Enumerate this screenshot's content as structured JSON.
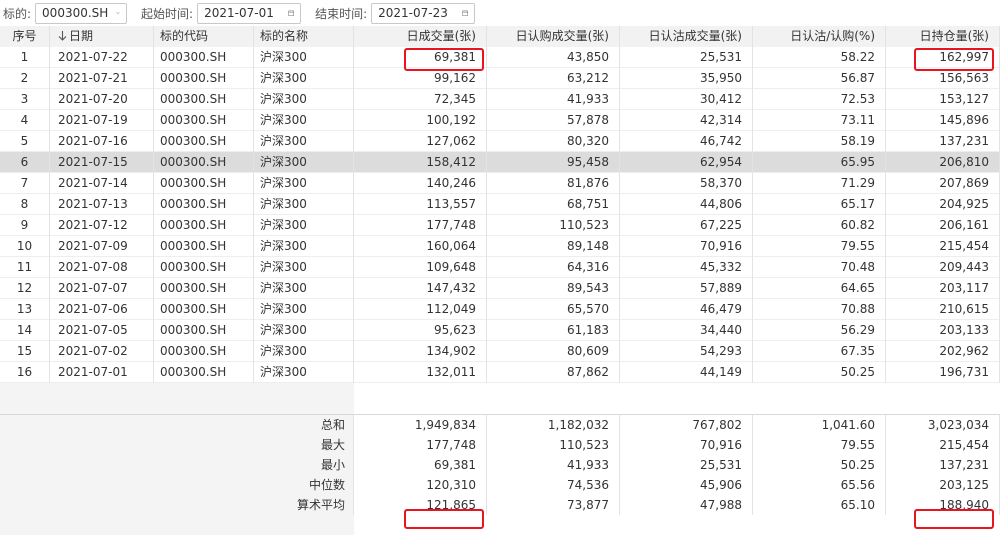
{
  "toolbar": {
    "symbol_label": "标的:",
    "symbol_value": "000300.SH",
    "start_label": "起始时间:",
    "start_value": "2021-07-01",
    "end_label": "结束时间:",
    "end_value": "2021-07-23"
  },
  "table": {
    "headers": [
      "序号",
      "日期",
      "标的代码",
      "标的名称",
      "日成交量(张)",
      "日认购成交量(张)",
      "日认沽成交量(张)",
      "日认沽/认购(%)",
      "日持仓量(张)"
    ],
    "rows": [
      [
        "1",
        "2021-07-22",
        "000300.SH",
        "沪深300",
        "69,381",
        "43,850",
        "25,531",
        "58.22",
        "162,997"
      ],
      [
        "2",
        "2021-07-21",
        "000300.SH",
        "沪深300",
        "99,162",
        "63,212",
        "35,950",
        "56.87",
        "156,563"
      ],
      [
        "3",
        "2021-07-20",
        "000300.SH",
        "沪深300",
        "72,345",
        "41,933",
        "30,412",
        "72.53",
        "153,127"
      ],
      [
        "4",
        "2021-07-19",
        "000300.SH",
        "沪深300",
        "100,192",
        "57,878",
        "42,314",
        "73.11",
        "145,896"
      ],
      [
        "5",
        "2021-07-16",
        "000300.SH",
        "沪深300",
        "127,062",
        "80,320",
        "46,742",
        "58.19",
        "137,231"
      ],
      [
        "6",
        "2021-07-15",
        "000300.SH",
        "沪深300",
        "158,412",
        "95,458",
        "62,954",
        "65.95",
        "206,810"
      ],
      [
        "7",
        "2021-07-14",
        "000300.SH",
        "沪深300",
        "140,246",
        "81,876",
        "58,370",
        "71.29",
        "207,869"
      ],
      [
        "8",
        "2021-07-13",
        "000300.SH",
        "沪深300",
        "113,557",
        "68,751",
        "44,806",
        "65.17",
        "204,925"
      ],
      [
        "9",
        "2021-07-12",
        "000300.SH",
        "沪深300",
        "177,748",
        "110,523",
        "67,225",
        "60.82",
        "206,161"
      ],
      [
        "10",
        "2021-07-09",
        "000300.SH",
        "沪深300",
        "160,064",
        "89,148",
        "70,916",
        "79.55",
        "215,454"
      ],
      [
        "11",
        "2021-07-08",
        "000300.SH",
        "沪深300",
        "109,648",
        "64,316",
        "45,332",
        "70.48",
        "209,443"
      ],
      [
        "12",
        "2021-07-07",
        "000300.SH",
        "沪深300",
        "147,432",
        "89,543",
        "57,889",
        "64.65",
        "203,117"
      ],
      [
        "13",
        "2021-07-06",
        "000300.SH",
        "沪深300",
        "112,049",
        "65,570",
        "46,479",
        "70.88",
        "210,615"
      ],
      [
        "14",
        "2021-07-05",
        "000300.SH",
        "沪深300",
        "95,623",
        "61,183",
        "34,440",
        "56.29",
        "203,133"
      ],
      [
        "15",
        "2021-07-02",
        "000300.SH",
        "沪深300",
        "134,902",
        "80,609",
        "54,293",
        "67.35",
        "202,962"
      ],
      [
        "16",
        "2021-07-01",
        "000300.SH",
        "沪深300",
        "132,011",
        "87,862",
        "44,149",
        "50.25",
        "196,731"
      ]
    ],
    "summary": [
      [
        "总和",
        "1,949,834",
        "1,182,032",
        "767,802",
        "1,041.60",
        "3,023,034"
      ],
      [
        "最大",
        "177,748",
        "110,523",
        "70,916",
        "79.55",
        "215,454"
      ],
      [
        "最小",
        "69,381",
        "41,933",
        "25,531",
        "50.25",
        "137,231"
      ],
      [
        "中位数",
        "120,310",
        "74,536",
        "45,906",
        "65.56",
        "203,125"
      ],
      [
        "算术平均",
        "121,865",
        "73,877",
        "47,988",
        "65.10",
        "188,940"
      ]
    ]
  },
  "colors": {
    "highlight": "#e8141e",
    "selected_row": "#dcdcdc",
    "header_bg": "#f2f2f2"
  },
  "icons": {
    "dropdown": "chevron-down-icon",
    "date": "calendar-icon",
    "sort": "sort-down-arrow-icon"
  }
}
